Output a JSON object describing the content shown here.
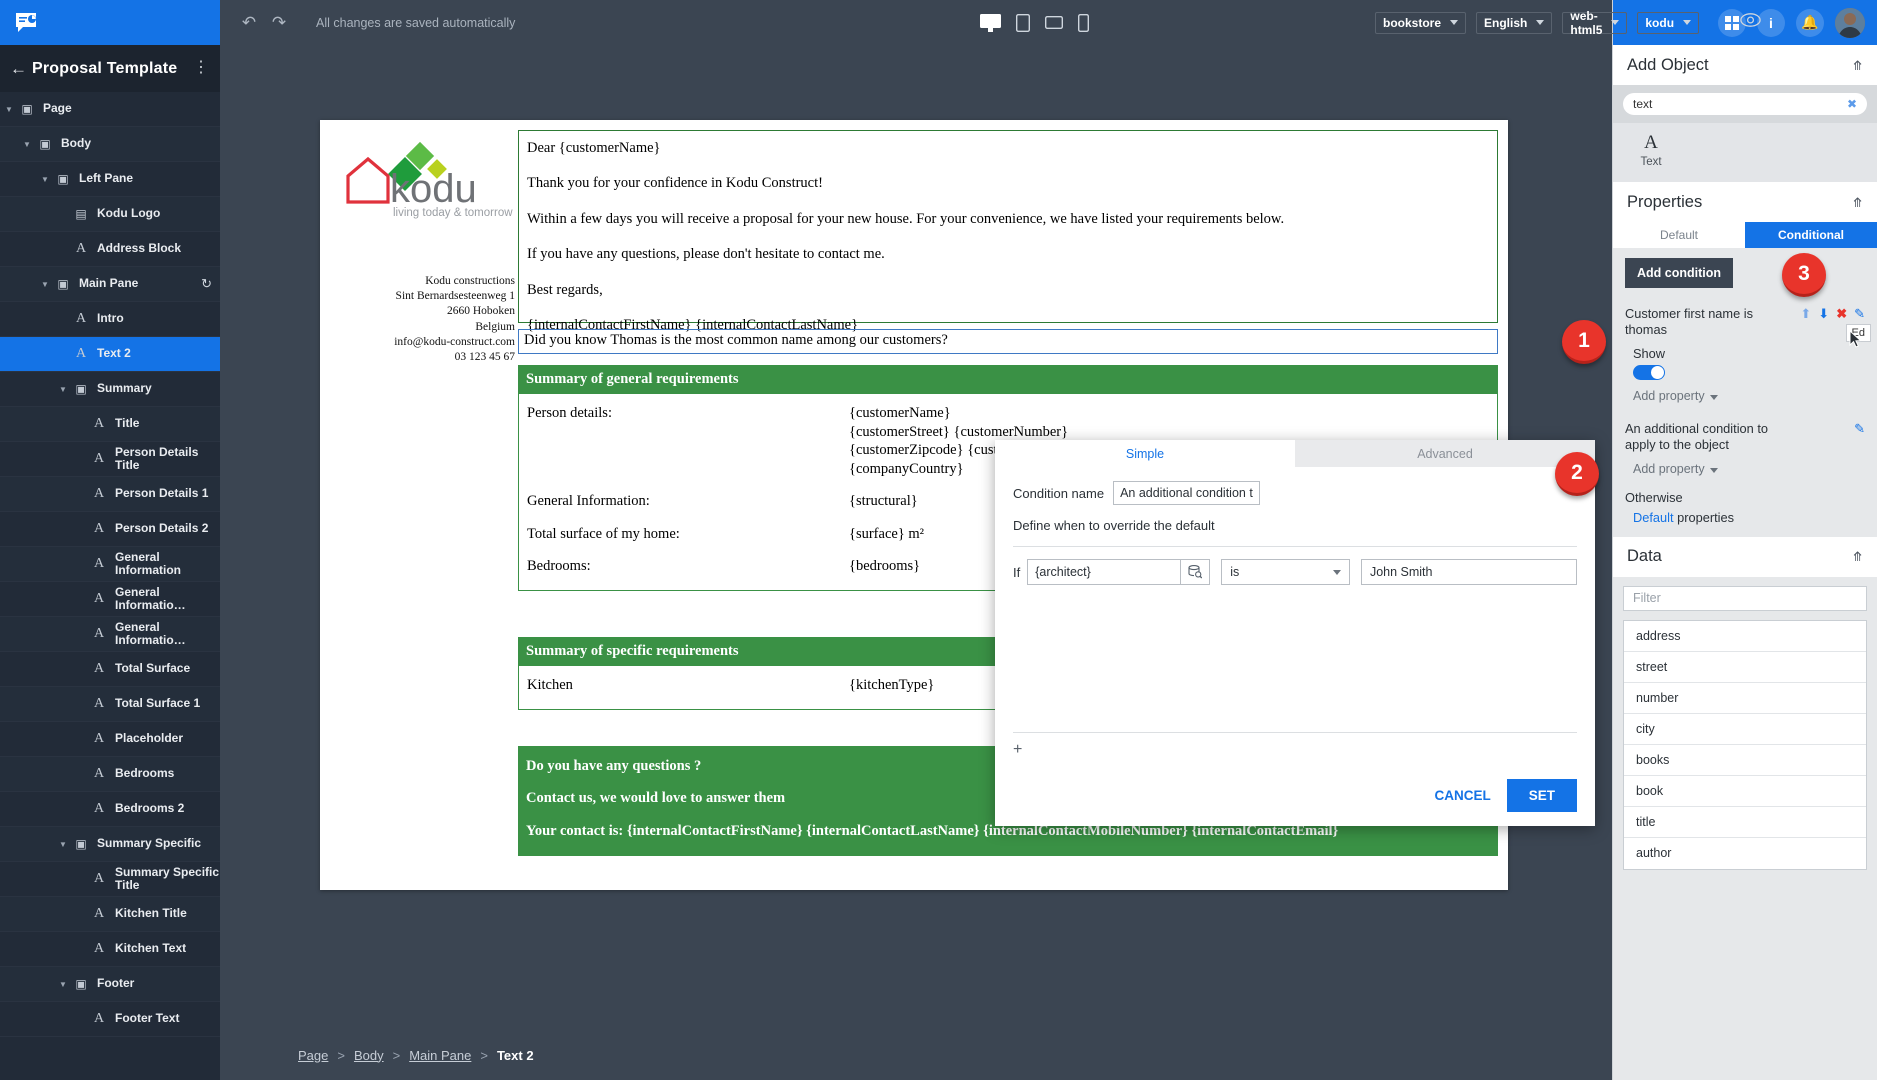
{
  "sidebar": {
    "app_icon": "chat-analytics-icon",
    "title": "Proposal Template",
    "back_icon": "back-arrow-icon",
    "kebab_icon": "more-vertical-icon",
    "tree": [
      {
        "label": "Page",
        "indent": 0,
        "icon": "frame-icon",
        "twisty": "down",
        "selected": false
      },
      {
        "label": "Body",
        "indent": 1,
        "icon": "frame-icon",
        "twisty": "down",
        "selected": false
      },
      {
        "label": "Left Pane",
        "indent": 2,
        "icon": "frame-icon",
        "twisty": "down",
        "selected": false
      },
      {
        "label": "Kodu Logo",
        "indent": 3,
        "icon": "image-icon",
        "twisty": "",
        "selected": false
      },
      {
        "label": "Address Block",
        "indent": 3,
        "icon": "text-icon",
        "twisty": "",
        "selected": false
      },
      {
        "label": "Main Pane",
        "indent": 2,
        "icon": "frame-icon",
        "twisty": "down",
        "selected": false,
        "refresh": true
      },
      {
        "label": "Intro",
        "indent": 3,
        "icon": "text-icon",
        "twisty": "",
        "selected": false
      },
      {
        "label": "Text 2",
        "indent": 3,
        "icon": "text-icon",
        "twisty": "",
        "selected": true
      },
      {
        "label": "Summary",
        "indent": 3,
        "icon": "frame-icon",
        "twisty": "down",
        "selected": false
      },
      {
        "label": "Title",
        "indent": 4,
        "icon": "text-icon",
        "twisty": "",
        "selected": false
      },
      {
        "label": "Person Details Title",
        "indent": 4,
        "icon": "text-icon",
        "twisty": "",
        "selected": false
      },
      {
        "label": "Person Details 1",
        "indent": 4,
        "icon": "text-icon",
        "twisty": "",
        "selected": false
      },
      {
        "label": "Person Details 2",
        "indent": 4,
        "icon": "text-icon",
        "twisty": "",
        "selected": false
      },
      {
        "label": "General Information",
        "indent": 4,
        "icon": "text-icon",
        "twisty": "",
        "selected": false
      },
      {
        "label": "General Informatio…",
        "indent": 4,
        "icon": "text-icon",
        "twisty": "",
        "selected": false
      },
      {
        "label": "General Informatio…",
        "indent": 4,
        "icon": "text-icon",
        "twisty": "",
        "selected": false
      },
      {
        "label": "Total Surface",
        "indent": 4,
        "icon": "text-icon",
        "twisty": "",
        "selected": false
      },
      {
        "label": "Total Surface 1",
        "indent": 4,
        "icon": "text-icon",
        "twisty": "",
        "selected": false
      },
      {
        "label": "Placeholder",
        "indent": 4,
        "icon": "text-icon",
        "twisty": "",
        "selected": false
      },
      {
        "label": "Bedrooms",
        "indent": 4,
        "icon": "text-icon",
        "twisty": "",
        "selected": false
      },
      {
        "label": "Bedrooms 2",
        "indent": 4,
        "icon": "text-icon",
        "twisty": "",
        "selected": false
      },
      {
        "label": "Summary Specific",
        "indent": 3,
        "icon": "frame-icon",
        "twisty": "down",
        "selected": false
      },
      {
        "label": "Summary Specific Title",
        "indent": 4,
        "icon": "text-icon",
        "twisty": "",
        "selected": false
      },
      {
        "label": "Kitchen Title",
        "indent": 4,
        "icon": "text-icon",
        "twisty": "",
        "selected": false
      },
      {
        "label": "Kitchen Text",
        "indent": 4,
        "icon": "text-icon",
        "twisty": "",
        "selected": false
      },
      {
        "label": "Footer",
        "indent": 3,
        "icon": "frame-icon",
        "twisty": "down",
        "selected": false
      },
      {
        "label": "Footer Text",
        "indent": 4,
        "icon": "text-icon",
        "twisty": "",
        "selected": false
      }
    ]
  },
  "toolbar": {
    "undo_icon": "undo-icon",
    "redo_icon": "redo-icon",
    "status": "All changes are saved automatically",
    "devices": [
      {
        "name": "desktop-icon",
        "active": true
      },
      {
        "name": "tablet-portrait-icon",
        "active": false
      },
      {
        "name": "tablet-landscape-icon",
        "active": false
      },
      {
        "name": "mobile-icon",
        "active": false
      }
    ],
    "selects": [
      {
        "name": "project-select",
        "value": "bookstore"
      },
      {
        "name": "language-select",
        "value": "English"
      },
      {
        "name": "output-select",
        "value": "web-html5"
      },
      {
        "name": "brand-select",
        "value": "kodu"
      }
    ],
    "preview_icon": "eye-icon"
  },
  "document": {
    "logo": {
      "brand": "kodu",
      "tagline": "living today & tomorrow"
    },
    "address": [
      "Kodu constructions",
      "Sint Bernardsesteenweg 1",
      "2660 Hoboken",
      "Belgium",
      "info@kodu-construct.com",
      "03 123 45 67"
    ],
    "intro": [
      "Dear {customerName}",
      "Thank you for your confidence in Kodu Construct!",
      "Within a few days you will receive a proposal for your new house. For your convenience, we have listed your requirements below.",
      "If you have any questions, please don't hesitate to contact me.",
      "Best regards,",
      "{internalContactFirstName} {internalContactLastName}"
    ],
    "text2": "Did you know Thomas is the most common name among our customers?",
    "general": {
      "heading": "Summary of general requirements",
      "rows": [
        {
          "key": "Person details:",
          "value": "{customerName}\n{customerStreet} {customerNumber}\n{customerZipcode} {customerCity}\n{companyCountry}"
        },
        {
          "key": "General Information:",
          "value": "{structural}"
        },
        {
          "key": "Total surface of my home:",
          "value": "{surface} m²"
        },
        {
          "key": "Bedrooms:",
          "value": "{bedrooms}"
        }
      ]
    },
    "specific": {
      "heading": "Summary of specific requirements",
      "rows": [
        {
          "key": "Kitchen",
          "value": "{kitchenType}"
        }
      ]
    },
    "footer": [
      "Do you have any questions ?",
      "Contact us, we would love to answer them",
      "Your contact is: {internalContactFirstName} {internalContactLastName} {internalContactMobileNumber} {internalContactEmail}"
    ]
  },
  "breadcrumb": {
    "items": [
      "Page",
      "Body",
      "Main Pane"
    ],
    "current": "Text 2",
    "separator": ">"
  },
  "right_header": {
    "apps_icon": "grid-apps-icon",
    "info_icon": "info-icon",
    "bell_icon": "notification-bell-icon",
    "avatar": "user-avatar"
  },
  "add_object": {
    "title": "Add Object",
    "collapse_icon": "collapse-icon",
    "search_value": "text",
    "clear_icon": "clear-x-icon",
    "results": [
      {
        "glyph": "A",
        "label": "Text",
        "icon": "text-object-icon"
      }
    ]
  },
  "properties": {
    "title": "Properties",
    "collapse_icon": "collapse-icon",
    "tabs": [
      {
        "label": "Default",
        "active": false
      },
      {
        "label": "Conditional",
        "active": true
      }
    ],
    "add_condition_label": "Add condition",
    "condition_1": {
      "name": "Customer first name is thomas",
      "actions": [
        "move-up-icon",
        "move-down-icon",
        "delete-icon",
        "edit-pencil-icon"
      ],
      "tooltip": "Ed",
      "show_label": "Show",
      "show_on": true,
      "add_property_label": "Add property"
    },
    "condition_2": {
      "name": "An additional condition to apply to the object",
      "edit_icon": "edit-pencil-icon",
      "add_property_label": "Add property"
    },
    "otherwise_label": "Otherwise",
    "default_link": "Default",
    "default_suffix": " properties"
  },
  "data_panel": {
    "title": "Data",
    "collapse_icon": "collapse-icon",
    "filter_placeholder": "Filter",
    "items": [
      "address",
      "street",
      "number",
      "city",
      "books",
      "book",
      "title",
      "author"
    ]
  },
  "modal": {
    "tabs": [
      {
        "label": "Simple",
        "active": true
      },
      {
        "label": "Advanced",
        "active": false
      }
    ],
    "condition_name_label": "Condition name",
    "condition_name_value": "An additional condition t",
    "define_hint": "Define when to override the default",
    "if_label": "If",
    "if_field_value": "{architect}",
    "db_icon": "database-picker-icon",
    "operator_value": "is",
    "compare_value": "John Smith",
    "add_row_icon": "plus-icon",
    "cancel_label": "CANCEL",
    "set_label": "SET"
  },
  "callouts": [
    {
      "number": "1",
      "name": "callout-1"
    },
    {
      "number": "2",
      "name": "callout-2"
    },
    {
      "number": "3",
      "name": "callout-3"
    }
  ],
  "colors": {
    "accent_blue": "#1473e6",
    "dark_chrome": "#3b4552",
    "sidebar_dark": "#222b38",
    "doc_green": "#3a9145",
    "callout_red": "#e8342b"
  }
}
